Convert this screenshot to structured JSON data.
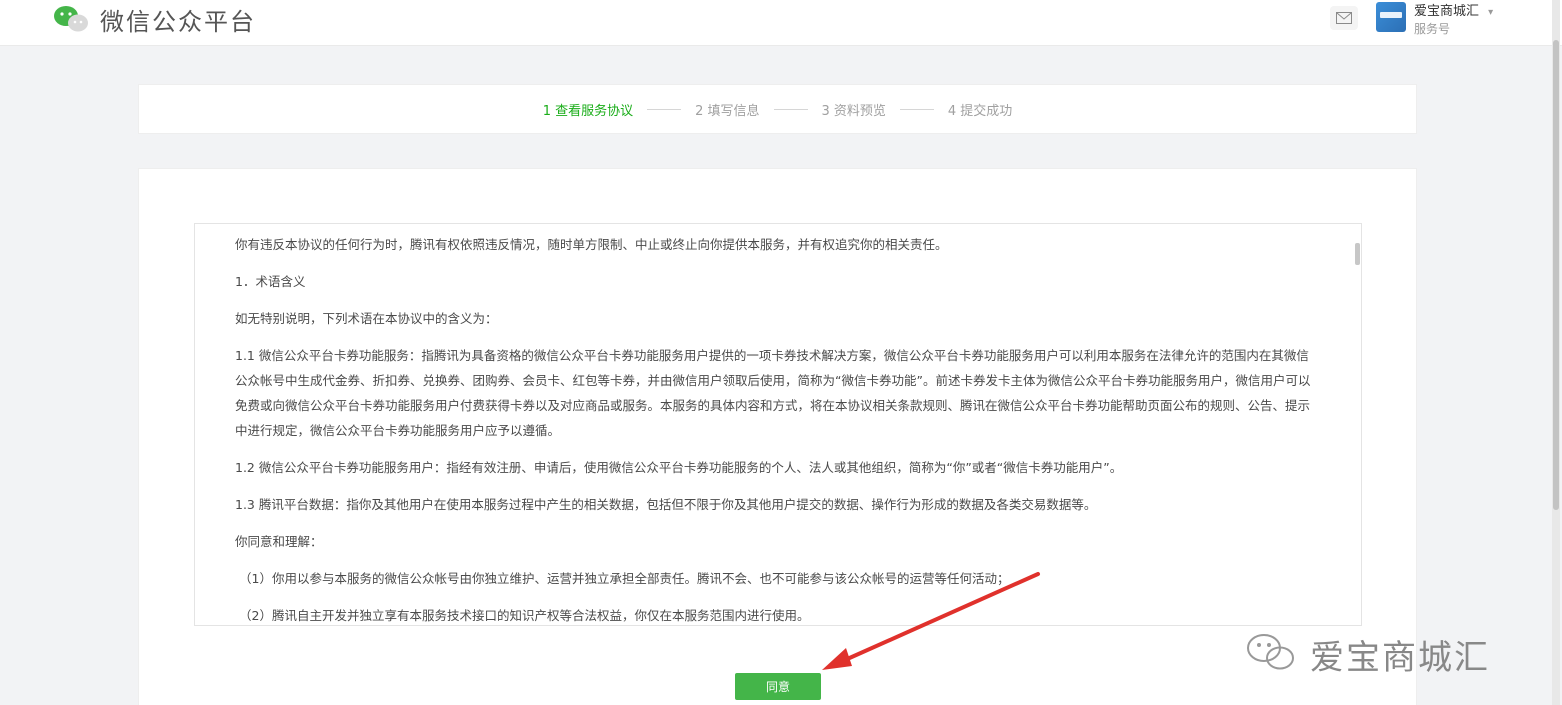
{
  "header": {
    "logo_text": "微信公众平台",
    "account_name": "爱宝商城汇",
    "account_type": "服务号",
    "account_caret": "▾"
  },
  "steps": [
    {
      "label": "1 查看服务协议",
      "active": true
    },
    {
      "label": "2 填写信息",
      "active": false
    },
    {
      "label": "3 资料预览",
      "active": false
    },
    {
      "label": "4 提交成功",
      "active": false
    }
  ],
  "agreement": {
    "paragraphs": [
      "你有违反本协议的任何行为时，腾讯有权依照违反情况，随时单方限制、中止或终止向你提供本服务，并有权追究你的相关责任。",
      "1．术语含义",
      "如无特别说明，下列术语在本协议中的含义为：",
      "1.1 微信公众平台卡券功能服务：指腾讯为具备资格的微信公众平台卡券功能服务用户提供的一项卡券技术解决方案，微信公众平台卡券功能服务用户可以利用本服务在法律允许的范围内在其微信公众帐号中生成代金券、折扣券、兑换券、团购券、会员卡、红包等卡券，并由微信用户领取后使用，简称为“微信卡券功能”。前述卡券发卡主体为微信公众平台卡券功能服务用户，微信用户可以免费或向微信公众平台卡券功能服务用户付费获得卡券以及对应商品或服务。本服务的具体内容和方式，将在本协议相关条款规则、腾讯在微信公众平台卡券功能帮助页面公布的规则、公告、提示中进行规定，微信公众平台卡券功能服务用户应予以遵循。",
      "1.2 微信公众平台卡券功能服务用户：指经有效注册、申请后，使用微信公众平台卡券功能服务的个人、法人或其他组织，简称为“你”或者“微信卡券功能用户”。",
      "1.3 腾讯平台数据：指你及其他用户在使用本服务过程中产生的相关数据，包括但不限于你及其他用户提交的数据、操作行为形成的数据及各类交易数据等。",
      "你同意和理解：",
      "（1）你用以参与本服务的微信公众帐号由你独立维护、运营并独立承担全部责任。腾讯不会、也不可能参与该公众帐号的运营等任何活动；",
      "（2）腾讯自主开发并独立享有本服务技术接口的知识产权等合法权益，你仅在本服务范围内进行使用。"
    ]
  },
  "agree_button": "同意",
  "watermark": "爱宝商城汇",
  "colors": {
    "brand_green": "#44b549",
    "step_active": "#1aad19",
    "arrow_red": "#e0312c"
  }
}
